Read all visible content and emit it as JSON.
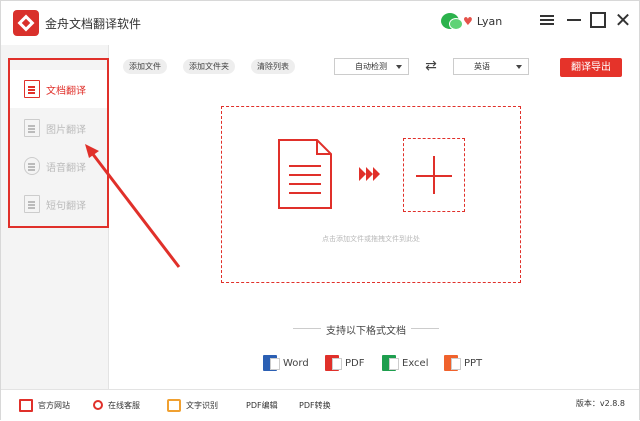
{
  "app": {
    "title": "金舟文档翻译软件",
    "user_name": "Lyan"
  },
  "sidebar": {
    "items": [
      {
        "label": "文档翻译",
        "icon": "document-icon",
        "active": true
      },
      {
        "label": "图片翻译",
        "icon": "image-icon",
        "active": false
      },
      {
        "label": "语音翻译",
        "icon": "microphone-icon",
        "active": false
      },
      {
        "label": "短句翻译",
        "icon": "text-icon",
        "active": false
      }
    ]
  },
  "toolbar": {
    "add_file": "添加文件",
    "add_folder": "添加文件夹",
    "clear_list": "清除列表",
    "source_lang": "自动检测",
    "target_lang": "英语",
    "export_label": "翻译导出"
  },
  "dropzone": {
    "hint": "点击添加文件或拖拽文件到此处"
  },
  "formats": {
    "title": "支持以下格式文档",
    "items": [
      {
        "label": "Word",
        "icon": "word-icon",
        "color": "#2b5fb3"
      },
      {
        "label": "PDF",
        "icon": "pdf-icon",
        "color": "#e0302a"
      },
      {
        "label": "Excel",
        "icon": "excel-icon",
        "color": "#1e9e4e"
      },
      {
        "label": "PPT",
        "icon": "ppt-icon",
        "color": "#f0622c"
      }
    ]
  },
  "footer": {
    "official_site": "官方网站",
    "online_service": "在线客服",
    "ocr": "文字识别",
    "pdf_edit": "PDF编辑",
    "pdf_convert": "PDF转换",
    "version": "版本：v2.8.8"
  },
  "colors": {
    "accent": "#e0302a",
    "sidebar_bg": "#f4f4f4"
  }
}
